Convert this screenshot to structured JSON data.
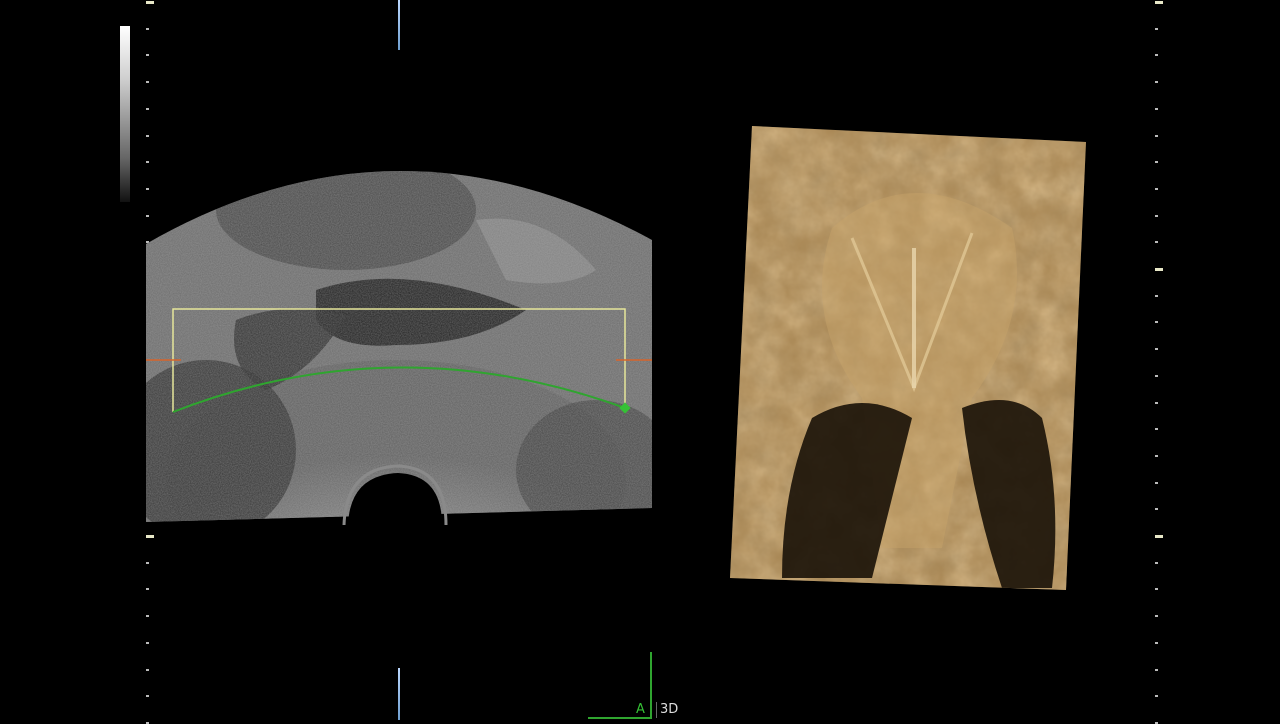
{
  "status_bar": {
    "mode_label_a": "A",
    "mode_label_3d": "3D"
  },
  "panels": {
    "left": {
      "type": "2D ultrasound",
      "roi_color": "#e6e69a",
      "render_line_color": "#2fa52f"
    },
    "right": {
      "type": "3D surface render",
      "tint": "#b8935a"
    }
  },
  "colors": {
    "background": "#000000",
    "accent_green": "#35c135",
    "marker_orange": "#d8642a",
    "scale_tick": "#e8e8c8"
  }
}
